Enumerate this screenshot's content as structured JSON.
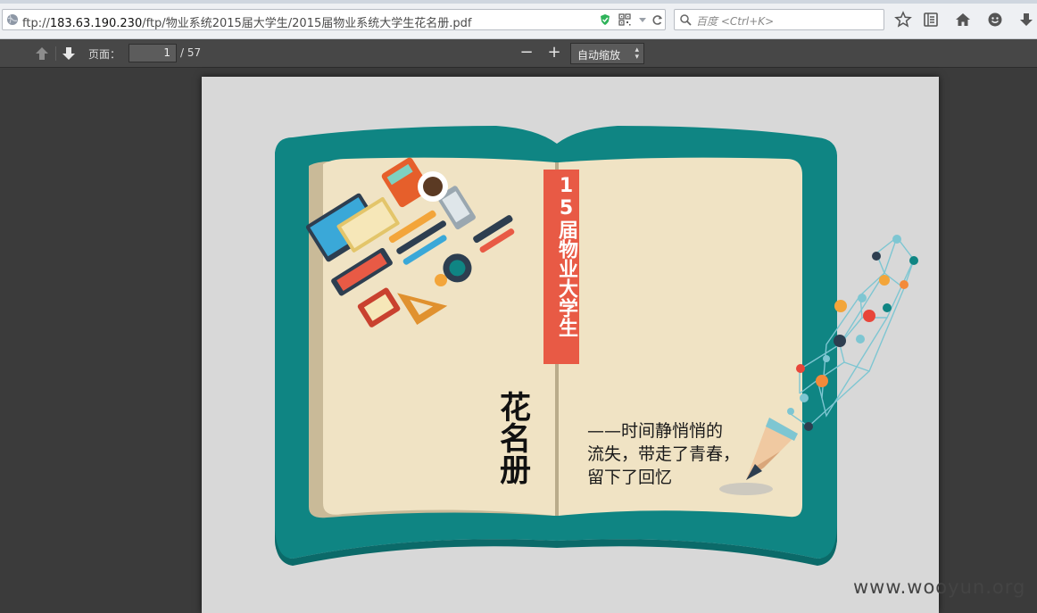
{
  "browser": {
    "url_prefix": "ftp://",
    "url_host": "183.63.190.230",
    "url_path": "/ftp/物业系统2015届大学生/2015届物业系统大学生花名册.pdf",
    "search_placeholder": "百度 <Ctrl+K>",
    "icons": [
      "globe-icon",
      "shield-icon",
      "qrcode-icon",
      "dropdown-icon",
      "reload-icon",
      "search-icon",
      "bookmark-star-icon",
      "reading-list-icon",
      "home-icon",
      "chat-icon",
      "download-icon"
    ]
  },
  "pdf_toolbar": {
    "page_label": "页面：",
    "current_page": "1",
    "total_pages": "/ 57",
    "zoom_out": "−",
    "zoom_in": "+",
    "zoom_value": "自动缩放"
  },
  "document": {
    "banner_text": "15届物业大学生",
    "title": "花名册",
    "caption_lines": [
      "——时间静悄悄的",
      "流失，带走了青春，",
      "留下了回忆"
    ],
    "colors": {
      "book_teal": "#0f8583",
      "paper": "#f0e3c4",
      "banner": "#e85a45"
    }
  },
  "watermark": "www.wooyun.org"
}
